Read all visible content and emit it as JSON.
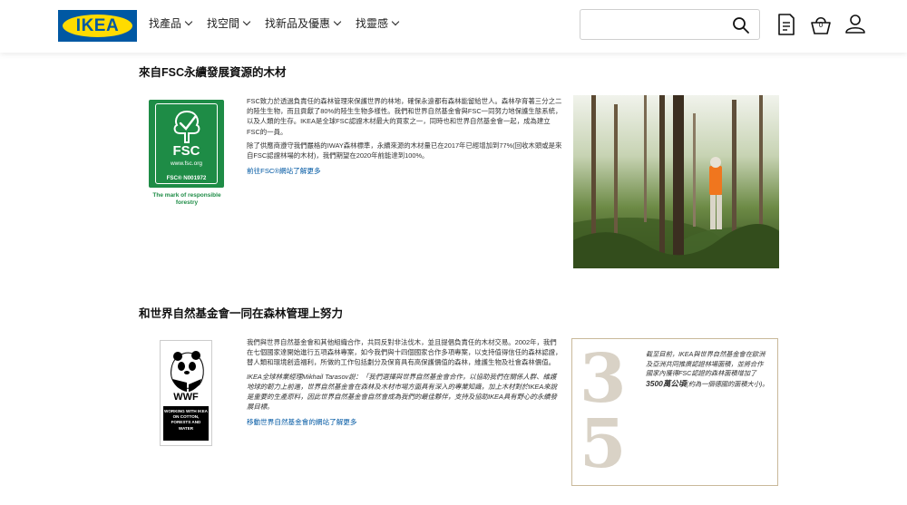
{
  "header": {
    "logo_text": "IKEA",
    "nav": [
      {
        "label": "找產品"
      },
      {
        "label": "找空間"
      },
      {
        "label": "找新品及優惠"
      },
      {
        "label": "找靈感"
      }
    ],
    "search_placeholder": "",
    "cart_count": "0",
    "colors": {
      "brand_blue": "#0058a3",
      "brand_yellow": "#ffdb00"
    }
  },
  "fsc_section": {
    "title": "來自FSC永續發展資源的木材",
    "paragraph1": "FSC致力於透過負責任的森林管理來保護世界的林地，確保永遠都有森林能留給世人。森林孕育著三分之二的陸生生物，而且貢獻了80%的陸生生物多樣性。我們和世界自然基金會與FSC一同努力地保護生態系統，以及人類的生存。IKEA是全球FSC認證木材最大的買家之一，同時也和世界自然基金會一起，成為建立FSC的一員。",
    "paragraph2": "除了供應商遵守我們嚴格的IWAY森林標準，永續來源的木材量已在2017年已經增加到77%(回收木頭或是來自FSC認證林場的木材)，我們期望在2020年前能達到100%。",
    "link": "前往FSC®網站了解更多",
    "logo": {
      "name": "FSC",
      "url": "www.fsc.org",
      "code": "FSC® N001972",
      "mark": "The mark of responsible forestry",
      "color": "#1e8c46"
    }
  },
  "wwf_section": {
    "title": "和世界自然基金會一同在森林管理上努力",
    "paragraph1": "我們與世界自然基金會和其他組織合作，共同反對非法伐木，並且提倡負責任的木材交易。2002年，我們在七個國家達開始進行五項森林專案，如今我們與十四個國家合作多項專案，以支持值得信任的森林認證，替人類和環境創造福利，所做的工作包括劃分及保育具有高保護價值的森林，維護生物及社會森林價值。",
    "paragraph2": "IKEA全球林業經理Mikhail Tarasov說：「我們選擇與世界自然基金會合作，以協助我們在關係人群、維護地球的韌力上前進，世界自然基金會在森林及木材市場方面具有深入的專業知識，加上木材對於IKEA來說是重要的生產原料，因此世界自然基金會自然會成為我們的最佳夥伴，支持及協助IKEA具有野心的永續發展目標。",
    "link": "移動世界自然基金會的網站了解更多",
    "logo": {
      "name": "WWF",
      "sub": "WORKING WITH IKEA ON COTTON, FORESTS AND WATER"
    },
    "stat": {
      "number": "35",
      "text_before": "截至目前，IKEA與世界自然基金會在歐洲及亞洲共同推廣認證林場面積，並將合作國家內獲得FSC認證的森林面積增加了",
      "highlight": "3500萬公頃",
      "text_after": "(約為一個德國的面積大小)。"
    }
  }
}
